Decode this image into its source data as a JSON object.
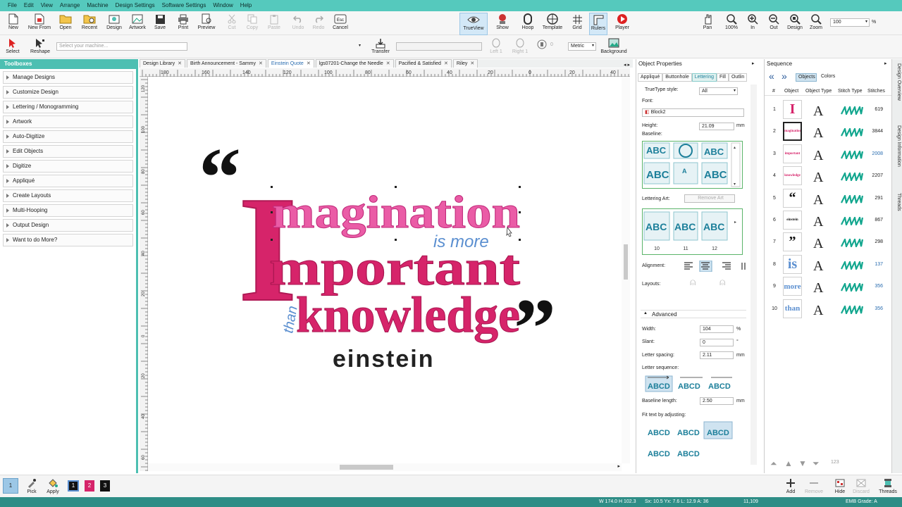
{
  "menu": [
    "File",
    "Edit",
    "View",
    "Arrange",
    "Machine",
    "Design Settings",
    "Software Settings",
    "Window",
    "Help"
  ],
  "ribbon": {
    "new": "New",
    "new_from": "New From",
    "open": "Open",
    "recent": "Recent",
    "design": "Design",
    "artwork": "Artwork",
    "save": "Save",
    "print": "Print",
    "preview": "Preview",
    "cut": "Cut",
    "copy": "Copy",
    "paste": "Paste",
    "undo": "Undo",
    "redo": "Redo",
    "cancel": "Cancel",
    "trueview": "TrueView",
    "show": "Show",
    "hoop": "Hoop",
    "template": "Template",
    "grid": "Grid",
    "rulers": "Rulers",
    "player": "Player",
    "pan": "Pan",
    "zoom100": "100%",
    "in": "In",
    "out": "Out",
    "design_zoom": "Design",
    "zoom": "Zoom",
    "zoom_value": "100",
    "percent": "%"
  },
  "ribbon2": {
    "select": "Select",
    "reshape": "Reshape",
    "machine_placeholder": "Select your machine...",
    "transfer": "Transfer",
    "left": "Left 1",
    "right": "Right 1",
    "zero": "0",
    "units": "Metric",
    "background": "Background"
  },
  "toolboxes": {
    "title": "Toolboxes",
    "items": [
      "Manage Designs",
      "Customize Design",
      "Lettering / Monogramming",
      "Artwork",
      "Auto-Digitize",
      "Edit Objects",
      "Digitize",
      "Appliqué",
      "Create Layouts",
      "Multi-Hooping",
      "Output Design",
      "Want to do More?"
    ]
  },
  "tabs": [
    {
      "label": "Design Library"
    },
    {
      "label": "Birth Announcement - Sammy"
    },
    {
      "label": "Einstein Quote"
    },
    {
      "label": "lgs07201-Change the Needle"
    },
    {
      "label": "Pacified & Satisfied"
    },
    {
      "label": "Riley"
    }
  ],
  "ruler": {
    "top": [
      "180",
      "160",
      "140",
      "120",
      "100",
      "80",
      "60",
      "40",
      "20",
      "0",
      "20",
      "40"
    ],
    "left": [
      "120",
      "100",
      "80",
      "60",
      "40",
      "20",
      "0",
      "20",
      "40",
      "60"
    ]
  },
  "design": {
    "quote_open": "“",
    "big_i": "I",
    "line1": "magination",
    "is_more": "is more",
    "line2": "mportant",
    "than": "than",
    "line3": "knowledge",
    "quote_close": "”",
    "author": "einstein"
  },
  "object_properties": {
    "title": "Object Properties",
    "tabs": [
      "Appliqué",
      "Buttonhole",
      "Lettering",
      "Fill",
      "Outlin"
    ],
    "truetype_label": "TrueType style:",
    "truetype_value": "All",
    "font_label": "Font:",
    "font_value": "Block2",
    "height_label": "Height:",
    "height_value": "21.09",
    "mm": "mm",
    "baseline_label": "Baseline:",
    "lettering_art_label": "Lettering Art:",
    "remove_art": "Remove Art",
    "art_numbers": [
      "10",
      "11",
      "12"
    ],
    "alignment_label": "Alignment:",
    "layouts_label": "Layouts:",
    "advanced": "Advanced",
    "width_label": "Width:",
    "width_value": "104",
    "percent": "%",
    "slant_label": "Slant:",
    "slant_value": "0",
    "deg": "°",
    "spacing_label": "Letter spacing:",
    "spacing_value": "2.11",
    "sequence_label": "Letter sequence:",
    "baseline_len_label": "Baseline length:",
    "baseline_len_value": "2.50",
    "fit_label": "Fit text by adjusting:",
    "abc": "ABC",
    "abcd": "ABCD"
  },
  "sequence": {
    "title": "Sequence",
    "tab_objects": "Objects",
    "tab_colors": "Colors",
    "headers": {
      "num": "#",
      "object": "Object",
      "type": "Object Type",
      "stitch": "Stitch Type",
      "stitches": "Stitches"
    },
    "rows": [
      {
        "n": "1",
        "thumb": "I",
        "stitches": "619",
        "color": "#d6246a"
      },
      {
        "n": "2",
        "thumb": "imagination",
        "stitches": "3844",
        "color": "#d6246a"
      },
      {
        "n": "3",
        "thumb": "important",
        "stitches": "2008",
        "color": "#d6246a"
      },
      {
        "n": "4",
        "thumb": "knowledge",
        "stitches": "2207",
        "color": "#d6246a"
      },
      {
        "n": "5",
        "thumb": "“",
        "stitches": "291",
        "color": "#111111"
      },
      {
        "n": "6",
        "thumb": "einstein",
        "stitches": "867",
        "color": "#111111"
      },
      {
        "n": "7",
        "thumb": "”",
        "stitches": "298",
        "color": "#111111"
      },
      {
        "n": "8",
        "thumb": "is",
        "stitches": "137",
        "color": "#5b8fd0"
      },
      {
        "n": "9",
        "thumb": "more",
        "stitches": "356",
        "color": "#5b8fd0"
      },
      {
        "n": "10",
        "thumb": "than",
        "stitches": "356",
        "color": "#5b8fd0"
      }
    ],
    "font_a": "A"
  },
  "siderail": [
    "Design Overview",
    "Design Information",
    "Threads"
  ],
  "bottom": {
    "pick": "Pick",
    "apply": "Apply",
    "swatches": [
      "1",
      "2",
      "3"
    ],
    "add": "Add",
    "remove": "Remove",
    "hide": "Hide",
    "discard": "Discard",
    "threads": "Threads",
    "num123": "123"
  },
  "status": {
    "dims": "W 174.0 H 102.3",
    "coords": "Sx: 10.5 Yx: 7.6 L: 12.9 A: 36",
    "count": "11,109",
    "grade": "EMB Grade: A"
  },
  "colors": {
    "accent": "#4dbfb2",
    "menu": "#55c9bd",
    "status": "#2e8d86",
    "pink": "#d6246a",
    "blue": "#5b8fd0",
    "teal": "#1c7f9a"
  }
}
